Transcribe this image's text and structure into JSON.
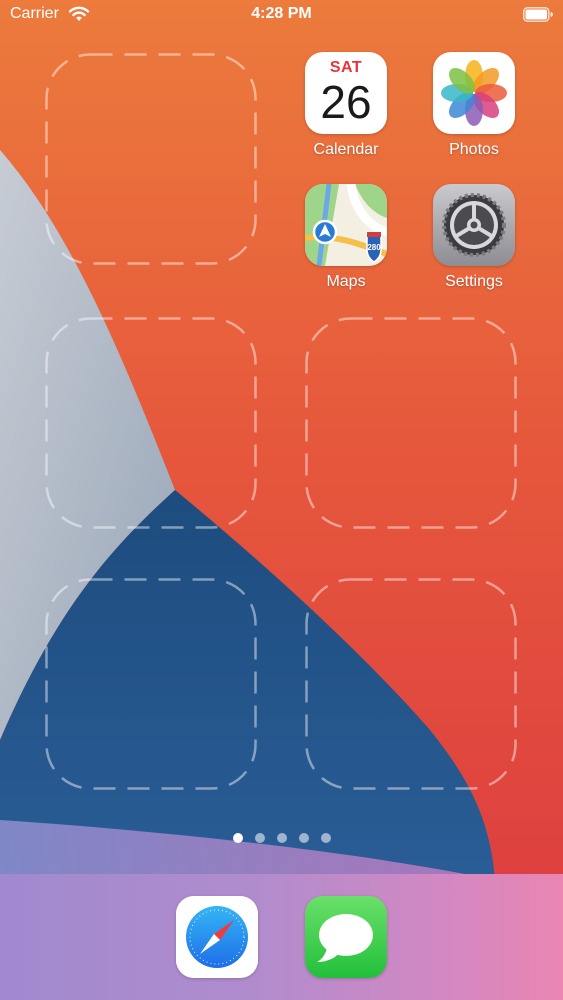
{
  "status_bar": {
    "carrier": "Carrier",
    "time": "4:28 PM",
    "wifi_icon": "wifi-icon",
    "battery_icon": "battery-icon"
  },
  "home": {
    "apps": [
      {
        "label": "Calendar",
        "icon": "calendar-icon",
        "calendar_day": "SAT",
        "calendar_date": "26"
      },
      {
        "label": "Photos",
        "icon": "photos-icon"
      },
      {
        "label": "Maps",
        "icon": "maps-icon",
        "highway_number": "280"
      },
      {
        "label": "Settings",
        "icon": "settings-icon"
      }
    ],
    "page_count": 5,
    "active_page": 1
  },
  "dock": {
    "apps": [
      {
        "icon": "safari-icon"
      },
      {
        "icon": "messages-icon"
      }
    ]
  },
  "colors": {
    "calendar_red": "#e8343b",
    "dock_left": "#a189cf",
    "dock_right": "#ea85b1",
    "messages_green": "#34c84a",
    "safari_blue": "#1e7ef0"
  }
}
